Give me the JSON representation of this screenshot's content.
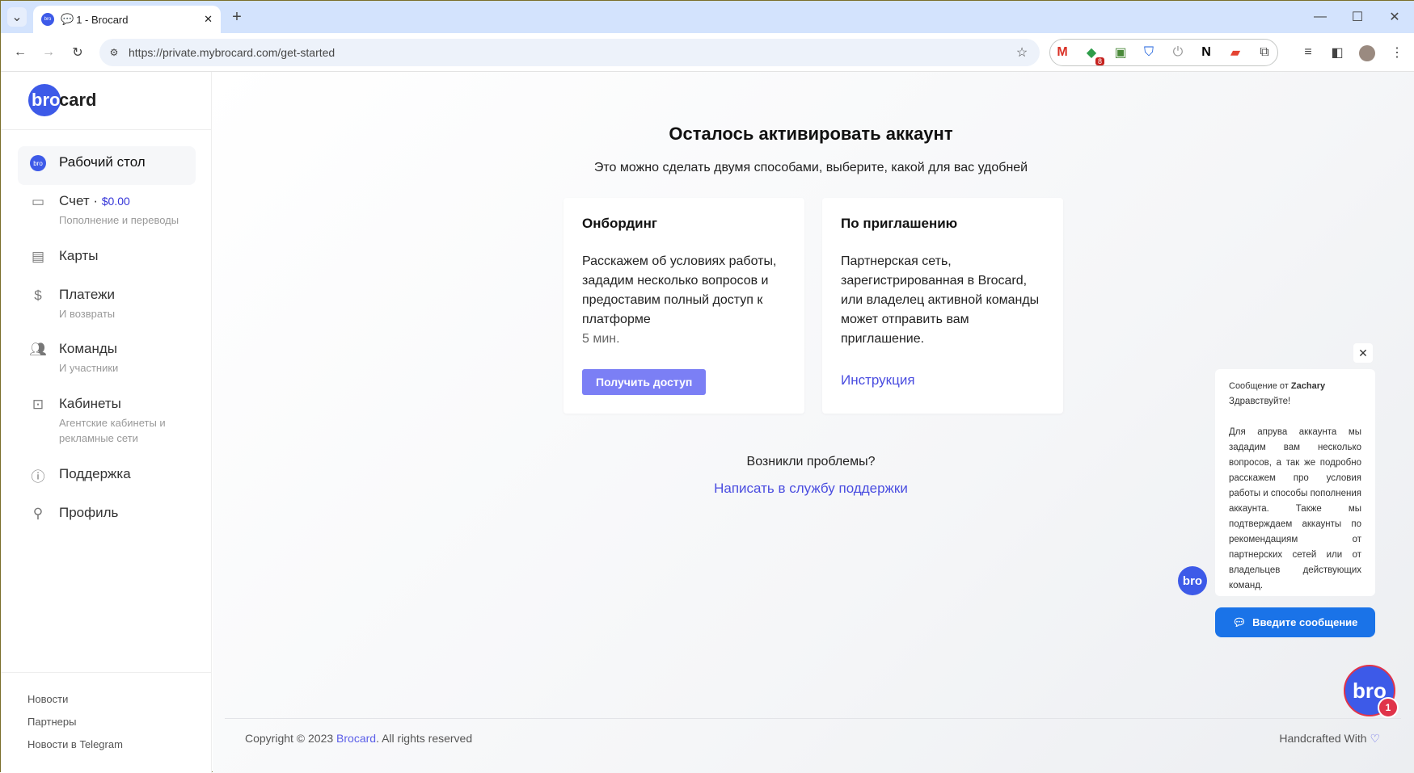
{
  "browser": {
    "tab_title": "1 - Brocard",
    "url": "https://private.mybrocard.com/get-started",
    "ext_badge": "8"
  },
  "sidebar": {
    "logo_bro": "bro",
    "logo_card": "card",
    "items": [
      {
        "label": "Рабочий стол"
      },
      {
        "label": "Счет ·",
        "amount": "$0.00",
        "sub": "Пополнение и переводы"
      },
      {
        "label": "Карты"
      },
      {
        "label": "Платежи",
        "sub": "И возвраты"
      },
      {
        "label": "Команды",
        "sub": "И участники"
      },
      {
        "label": "Кабинеты",
        "sub": "Агентские кабинеты и рекламные сети"
      },
      {
        "label": "Поддержка"
      },
      {
        "label": "Профиль"
      }
    ],
    "footer": [
      "Новости",
      "Партнеры",
      "Новости в Telegram"
    ]
  },
  "main": {
    "title": "Осталось активировать аккаунт",
    "subtitle": "Это можно сделать двумя способами, выберите, какой для вас удобней",
    "cards": [
      {
        "title": "Онбординг",
        "text": "Расскажем об условиях работы, зададим несколько вопросов и предоставим полный доступ к платформе",
        "time": "5 мин.",
        "button": "Получить доступ"
      },
      {
        "title": "По приглашению",
        "text": "Партнерская сеть, зарегистрированная в Brocard, или владелец активной команды может отправить вам приглашение.",
        "link": "Инструкция"
      }
    ],
    "problems": "Возникли проблемы?",
    "support_link": "Написать в службу поддержки"
  },
  "footer": {
    "copyright": "Copyright © 2023",
    "brand": "Brocard",
    "rights": ". All rights reserved",
    "handcrafted": "Handcrafted With"
  },
  "chat": {
    "from_prefix": "Сообщение от",
    "from_name": "Zachary",
    "greeting": "Здравствуйте!",
    "body": "Для апрува аккаунта мы зададим вам несколько вопросов, а так же подробно расскажем про условия работы и способы пополнения аккаунта. Также мы подтверждаем аккаунты по рекомендациям от партнерских сетей или от владельцев действующих команд.",
    "input_label": "Введите сообщение",
    "avatar": "bro",
    "unread": "1"
  },
  "colors": {
    "accent": "#3d5ae8",
    "button": "#7b7ff5",
    "link": "#4a4de0",
    "chat_blue": "#1a73e8"
  }
}
